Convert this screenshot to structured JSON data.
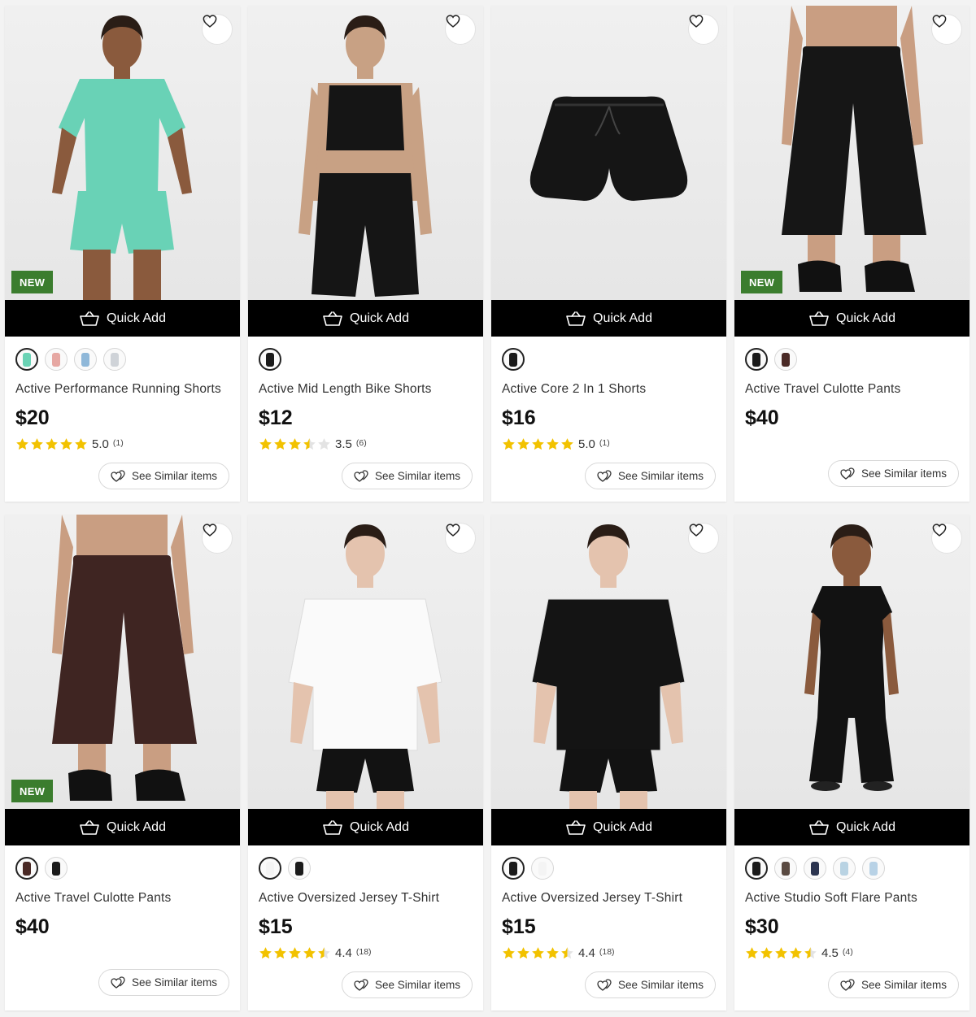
{
  "labels": {
    "quick_add": "Quick Add",
    "see_similar": "See Similar items",
    "new_badge": "NEW"
  },
  "colors": {
    "badge_green": "#3b7d2e",
    "star_yellow": "#f2c200",
    "bar_black": "#000000"
  },
  "products": [
    {
      "title": "Active Performance Running Shorts",
      "price": "$20",
      "new": true,
      "rating": "5.0",
      "reviews": "(1)",
      "stars": 5,
      "swatches": [
        "#6ad3b5",
        "#e6a7a2",
        "#8fb8d9",
        "#cfd3d8"
      ],
      "garment": "tee-shorts",
      "top_color": "#69d2b6",
      "bottom_color": "#69d2b6",
      "skin": "#8a5a3d"
    },
    {
      "title": "Active Mid Length Bike Shorts",
      "price": "$12",
      "new": false,
      "rating": "3.5",
      "reviews": "(6)",
      "stars": 3.5,
      "swatches": [
        "#1a1a1a"
      ],
      "garment": "bra-bike",
      "top_color": "#151515",
      "bottom_color": "#151515",
      "skin": "#c8a184"
    },
    {
      "title": "Active Core 2 In 1 Shorts",
      "price": "$16",
      "new": false,
      "rating": "5.0",
      "reviews": "(1)",
      "stars": 5,
      "swatches": [
        "#1a1a1a"
      ],
      "garment": "flat-shorts",
      "top_color": "#1a1a1a",
      "bottom_color": "#1a1a1a",
      "skin": "#ffffff"
    },
    {
      "title": "Active Travel Culotte Pants",
      "price": "$40",
      "new": true,
      "rating": "",
      "reviews": "",
      "stars": 0,
      "swatches": [
        "#1a1a1a",
        "#4a2a26"
      ],
      "garment": "culotte-crop",
      "top_color": "#e0e0e0",
      "bottom_color": "#161616",
      "skin": "#c99e82"
    },
    {
      "title": "Active Travel Culotte Pants",
      "price": "$40",
      "new": true,
      "rating": "",
      "reviews": "",
      "stars": 0,
      "swatches": [
        "#4a2a26",
        "#1a1a1a"
      ],
      "garment": "culotte-crop",
      "top_color": "#e0e0e0",
      "bottom_color": "#3f2522",
      "skin": "#c99e82"
    },
    {
      "title": "Active Oversized Jersey T-Shirt",
      "price": "$15",
      "new": false,
      "rating": "4.4",
      "reviews": "(18)",
      "stars": 4.5,
      "swatches": [
        "#f4f4f4",
        "#1a1a1a"
      ],
      "garment": "oversized-tee",
      "top_color": "#fafafa",
      "bottom_color": "#121212",
      "skin": "#e4c3ae"
    },
    {
      "title": "Active Oversized Jersey T-Shirt",
      "price": "$15",
      "new": false,
      "rating": "4.4",
      "reviews": "(18)",
      "stars": 4.5,
      "swatches": [
        "#1a1a1a",
        "#f4f4f4"
      ],
      "garment": "oversized-tee",
      "top_color": "#141414",
      "bottom_color": "#121212",
      "skin": "#e4c3ae"
    },
    {
      "title": "Active Studio Soft Flare Pants",
      "price": "$30",
      "new": false,
      "rating": "4.5",
      "reviews": "(4)",
      "stars": 4.5,
      "swatches": [
        "#1a1a1a",
        "#5a4a42",
        "#2c3550",
        "#b9d3e3",
        "#b8d2e6"
      ],
      "garment": "flare",
      "top_color": "#121212",
      "bottom_color": "#121212",
      "skin": "#8a5a3d"
    }
  ]
}
